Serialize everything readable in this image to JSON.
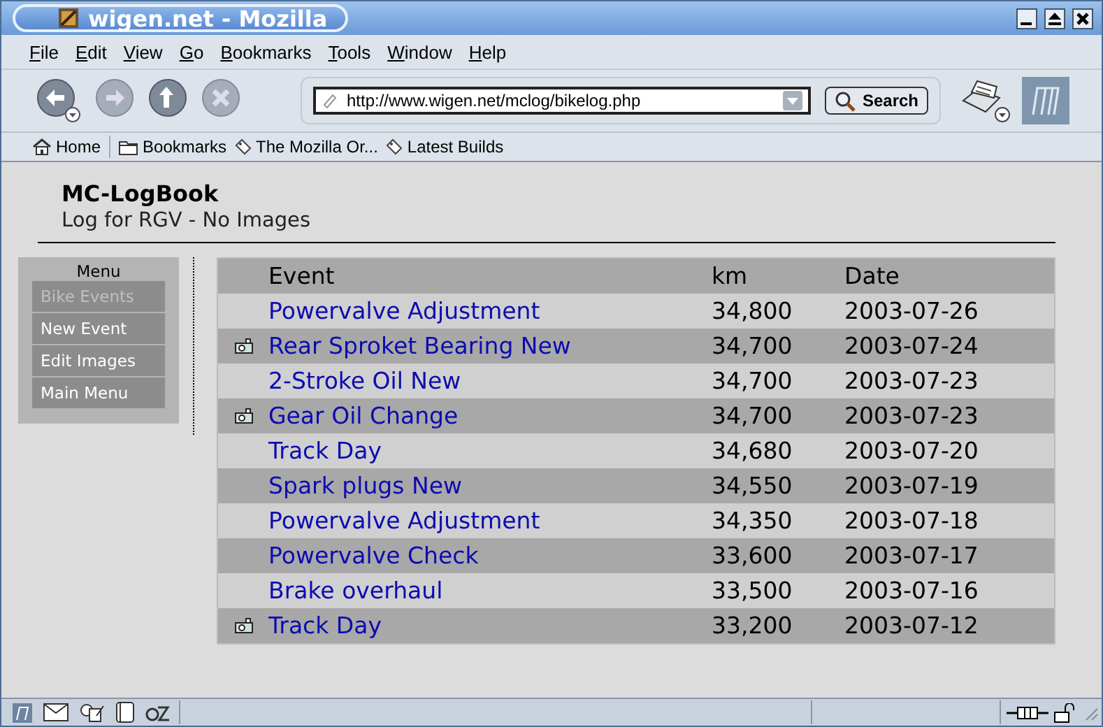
{
  "window": {
    "title": "wigen.net - Mozilla"
  },
  "menu_bar": [
    "File",
    "Edit",
    "View",
    "Go",
    "Bookmarks",
    "Tools",
    "Window",
    "Help"
  ],
  "navigation": {
    "url": "http://www.wigen.net/mclog/bikelog.php",
    "search_button": "Search"
  },
  "personal_toolbar": [
    {
      "kind": "home",
      "label": "Home"
    },
    {
      "kind": "folder",
      "label": "Bookmarks"
    },
    {
      "kind": "link",
      "label": "The Mozilla Or..."
    },
    {
      "kind": "link",
      "label": "Latest Builds"
    }
  ],
  "page": {
    "title": "MC-LogBook",
    "subtitle": "Log for RGV - No Images",
    "menu": {
      "heading": "Menu",
      "items": [
        {
          "label": "Bike Events",
          "disabled": true
        },
        {
          "label": "New Event",
          "disabled": false
        },
        {
          "label": "Edit Images",
          "disabled": false
        },
        {
          "label": "Main Menu",
          "disabled": false
        }
      ]
    },
    "table": {
      "columns": [
        "Event",
        "km",
        "Date"
      ],
      "rows": [
        {
          "photo": false,
          "event": "Powervalve Adjustment",
          "km": "34,800",
          "date": "2003-07-26"
        },
        {
          "photo": true,
          "event": "Rear Sproket Bearing New",
          "km": "34,700",
          "date": "2003-07-24"
        },
        {
          "photo": false,
          "event": "2-Stroke Oil New",
          "km": "34,700",
          "date": "2003-07-23"
        },
        {
          "photo": true,
          "event": "Gear Oil Change",
          "km": "34,700",
          "date": "2003-07-23"
        },
        {
          "photo": false,
          "event": "Track Day",
          "km": "34,680",
          "date": "2003-07-20"
        },
        {
          "photo": false,
          "event": "Spark plugs New",
          "km": "34,550",
          "date": "2003-07-19"
        },
        {
          "photo": false,
          "event": "Powervalve Adjustment",
          "km": "34,350",
          "date": "2003-07-18"
        },
        {
          "photo": false,
          "event": "Powervalve Check",
          "km": "33,600",
          "date": "2003-07-17"
        },
        {
          "photo": false,
          "event": "Brake overhaul",
          "km": "33,500",
          "date": "2003-07-16"
        },
        {
          "photo": true,
          "event": "Track Day",
          "km": "33,200",
          "date": "2003-07-12"
        }
      ]
    }
  }
}
